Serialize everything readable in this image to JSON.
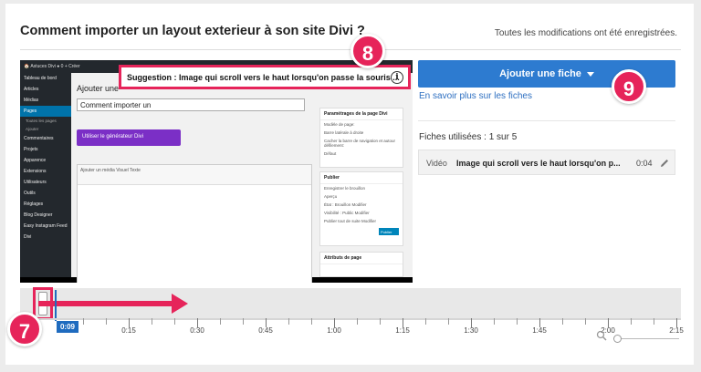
{
  "header": {
    "title": "Comment importer un layout exterieur à son site Divi ?",
    "status": "Toutes les modifications ont été enregistrées."
  },
  "video": {
    "wp_adminbar": "🏠 Astuces Divi   ● 0   + Créer",
    "wp_menu": [
      "Tableau de bord",
      "Articles",
      "Médias",
      "Pages",
      "Toutes les pages",
      "Ajouter",
      "Commentaires",
      "Projets",
      "Apparence",
      "Extensions",
      "Utilisateurs",
      "Outils",
      "Réglages",
      "Blog Designer",
      "Easy Instagram Feed",
      "Divi"
    ],
    "wp_heading": "Ajouter une",
    "wp_title_value": "Comment importer un",
    "wp_divi_button": "Utiliser le générateur Divi",
    "wp_editor_toolbar": "Ajouter un média          Visuel   Texte",
    "wp_box1_title": "Paramétrages de la page Divi",
    "wp_box1_lines": [
      "Modèle de page:",
      "Barre latérale à droite",
      "Cacher la barre de navigation et autour défilement:",
      "Défaut"
    ],
    "wp_box2_title": "Publier",
    "wp_box2_lines": [
      "Enregistrer le brouillon",
      "Aperçu",
      "État : Brouillon Modifier",
      "Visibilité : Public Modifier",
      "Publier tout de suite Modifier"
    ],
    "wp_publish_btn": "Publier",
    "wp_box3_title": "Attributs de page"
  },
  "suggestion": {
    "text": "Suggestion : Image qui scroll vers le haut lorsqu'on passe la souris ...",
    "icon": "info-icon"
  },
  "annotations": {
    "badge_8": "8",
    "badge_9": "9",
    "badge_7": "7",
    "accent_color": "#e6245a"
  },
  "panel": {
    "add_button": "Ajouter une fiche",
    "learn_link": "En savoir plus sur les fiches",
    "used_label": "Fiches utilisées : 1 sur 5",
    "card": {
      "type": "Vidéo",
      "title": "Image qui scroll vers le haut lorsqu'on p...",
      "time": "0:04"
    },
    "button_color": "#2d7bd0"
  },
  "timeline": {
    "current_time": "0:09",
    "handle_label": "≡",
    "ticks": [
      "0:15",
      "0:30",
      "0:45",
      "1:00",
      "1:15",
      "1:30",
      "1:45",
      "2:00",
      "2:15"
    ]
  }
}
